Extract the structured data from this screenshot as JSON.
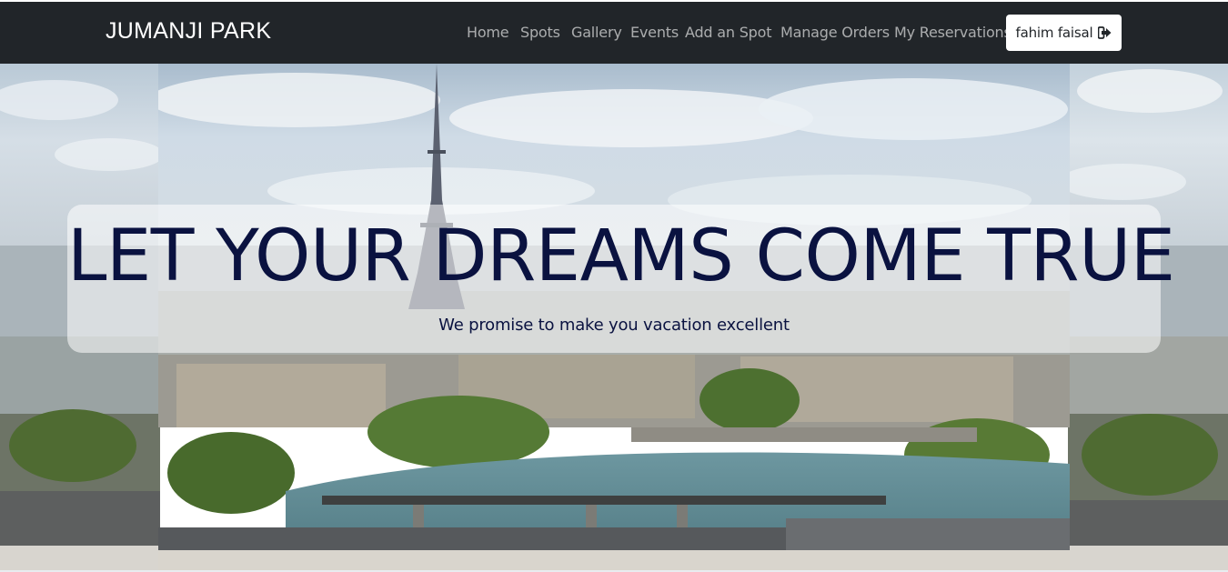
{
  "navbar": {
    "brand": "JUMANJI PARK",
    "links": [
      "Home",
      "Spots",
      "Gallery",
      "Events",
      "Add an Spot",
      "Manage Orders",
      "My Reservations"
    ],
    "user_button_label": "fahim faisal",
    "user_button_icon": "sign-out-icon"
  },
  "hero": {
    "title": "LET YOUR DREAMS COME TRUE",
    "subtitle": "We promise to make you vacation excellent"
  },
  "colors": {
    "navbar_bg": "#212529",
    "nav_link": "#a6a8aa",
    "headline": "#0a1240",
    "sky": "#c7d6e4",
    "water": "#5f8a93"
  }
}
